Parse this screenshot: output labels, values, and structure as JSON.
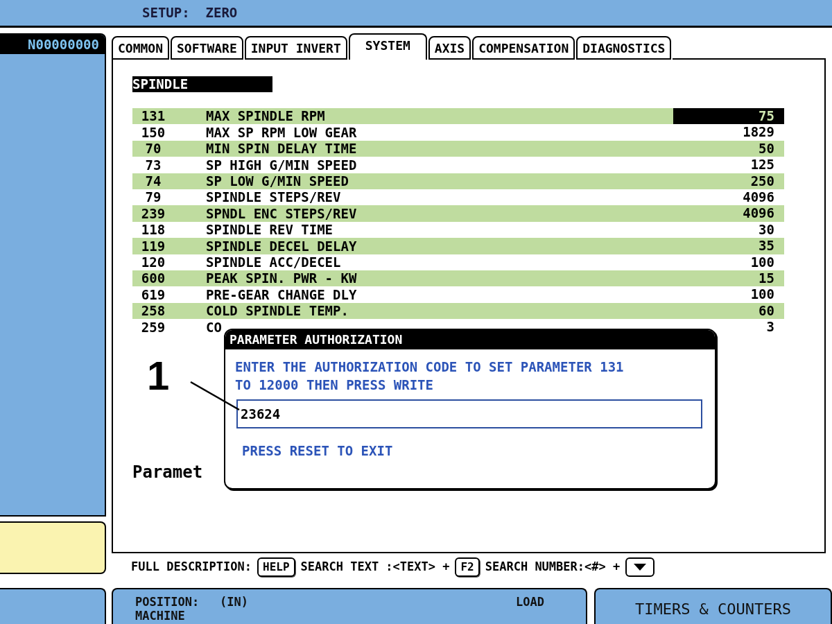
{
  "header": {
    "title": "SETUP:  ZERO"
  },
  "program_number": "N00000000",
  "tabs": [
    {
      "label": "COMMON",
      "selected": false
    },
    {
      "label": "SOFTWARE",
      "selected": false
    },
    {
      "label": "INPUT INVERT",
      "selected": false
    },
    {
      "label": "SYSTEM",
      "selected": true
    },
    {
      "label": "AXIS",
      "selected": false
    },
    {
      "label": "COMPENSATION",
      "selected": false
    },
    {
      "label": "DIAGNOSTICS",
      "selected": false
    }
  ],
  "section": "SPINDLE",
  "parameters": [
    {
      "number": "131",
      "name": "MAX SPINDLE RPM",
      "value": "75",
      "selected": true
    },
    {
      "number": "150",
      "name": "MAX SP RPM LOW GEAR",
      "value": "1829",
      "selected": false
    },
    {
      "number": "70",
      "name": "MIN SPIN DELAY TIME",
      "value": "50",
      "selected": false
    },
    {
      "number": "73",
      "name": "SP HIGH G/MIN SPEED",
      "value": "125",
      "selected": false
    },
    {
      "number": "74",
      "name": "SP LOW G/MIN SPEED",
      "value": "250",
      "selected": false
    },
    {
      "number": "79",
      "name": "SPINDLE STEPS/REV",
      "value": "4096",
      "selected": false
    },
    {
      "number": "239",
      "name": "SPNDL ENC STEPS/REV",
      "value": "4096",
      "selected": false
    },
    {
      "number": "118",
      "name": "SPINDLE REV TIME",
      "value": "30",
      "selected": false
    },
    {
      "number": "119",
      "name": "SPINDLE DECEL DELAY",
      "value": "35",
      "selected": false
    },
    {
      "number": "120",
      "name": "SPINDLE ACC/DECEL",
      "value": "100",
      "selected": false
    },
    {
      "number": "600",
      "name": "PEAK SPIN. PWR - KW",
      "value": "15",
      "selected": false
    },
    {
      "number": "619",
      "name": "PRE-GEAR CHANGE DLY",
      "value": "100",
      "selected": false
    },
    {
      "number": "258",
      "name": "COLD SPINDLE TEMP.",
      "value": "60",
      "selected": false
    },
    {
      "number": "259",
      "name": "CO",
      "value": "3",
      "selected": false
    }
  ],
  "background_text": "Paramet",
  "dialog": {
    "title": "PARAMETER AUTHORIZATION",
    "message": "ENTER THE AUTHORIZATION CODE TO SET PARAMETER 131 TO 12000 THEN PRESS WRITE",
    "value": "23624",
    "hint": "PRESS RESET TO EXIT"
  },
  "callout": "1",
  "help_bar": [
    {
      "kind": "text",
      "text": "FULL DESCRIPTION:"
    },
    {
      "kind": "key",
      "text": "HELP"
    },
    {
      "kind": "text",
      "text": "SEARCH TEXT :<TEXT> +"
    },
    {
      "kind": "key",
      "text": "F2"
    },
    {
      "kind": "text",
      "text": "SEARCH NUMBER:<#> +"
    },
    {
      "kind": "key_down"
    }
  ],
  "position_panel": {
    "title": "POSITION:",
    "unit": "(IN)",
    "load": "LOAD",
    "mode": "MACHINE"
  },
  "timers_panel": {
    "title": "TIMERS & COUNTERS"
  }
}
